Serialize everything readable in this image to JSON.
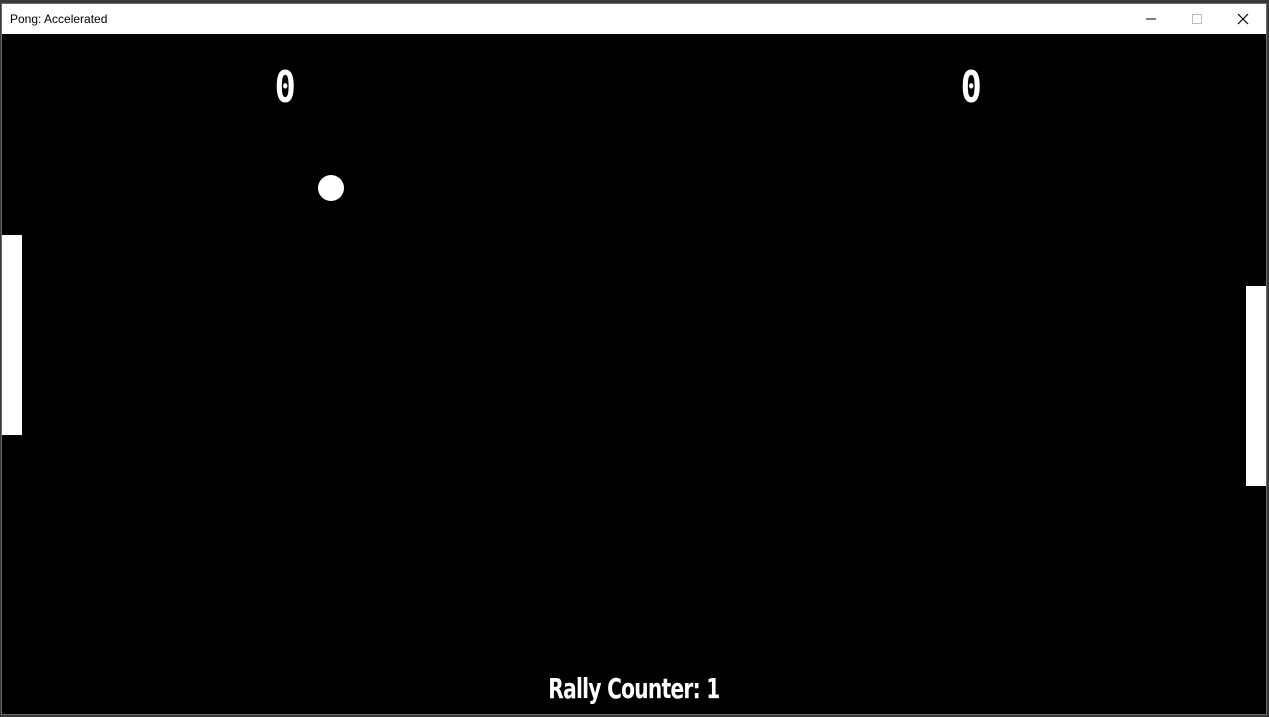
{
  "window": {
    "title": "Pong: Accelerated",
    "controls": {
      "minimize_icon": "minimize-icon",
      "maximize_icon": "maximize-icon",
      "close_icon": "close-icon"
    }
  },
  "game": {
    "score_left": "0",
    "score_right": "0",
    "rally_label": "Rally Counter: 1",
    "colors": {
      "background": "#000000",
      "foreground": "#ffffff"
    }
  }
}
